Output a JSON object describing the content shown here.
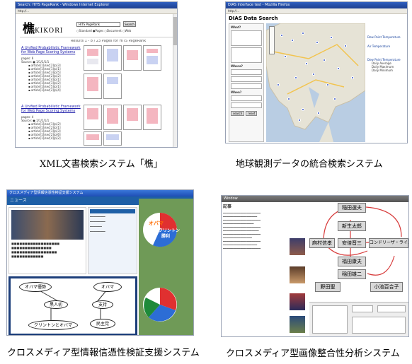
{
  "panels": {
    "kikori": {
      "window_title": "Search: HITS PageRank - Windows Internet Explorer",
      "logo_kanji": "樵",
      "logo_latin": "KIKORI",
      "search_value": "HITS PageRank",
      "search_button": "Search",
      "results_text": "Results 1 - 8 / 23 Pages for HITS PageRank",
      "result_title_1": "A Unified Probabilistic Framework for Web Page Scoring Systems",
      "result_title_2": "A Unified Probabilistic Framework for Web Page Scoring Systems",
      "caption": "XML文書検索システム「樵」"
    },
    "dias": {
      "window_title": "DIAS Interface test - Mozilla Firefox",
      "page_title": "DIAS Data Search",
      "label_what": "What?",
      "label_where": "Where?",
      "label_when": "When?",
      "search_button": "search",
      "reset_button": "reset",
      "legend_items": [
        "Dew Point Temperature",
        "Air Temperature",
        "Dew Point Temperature",
        "Daily Average",
        "Daily Maximum",
        "Daily Minimum"
      ],
      "caption": "地球観測データの統合検索システム"
    },
    "crossmedia_news": {
      "window_title": "クロスメディア型情報信憑性検証支援システム",
      "news_header": "ニュース",
      "pie_labels": [
        "オバマ",
        "クリントン",
        "勝利"
      ],
      "ovals": [
        "オバマ優勢",
        "オバマ",
        "黒人初",
        "支持",
        "クリントンとオバマ",
        "民主党"
      ],
      "caption": "クロスメディア型情報信憑性検証支援システム"
    },
    "image_consistency": {
      "nodes": [
        "稲田選夫",
        "新生太郎",
        "安倍晋三",
        "コンドリーザ・ライス",
        "麻村信孝",
        "福田康夫",
        "稲田雄二",
        "小池百合子",
        "野田聖"
      ],
      "caption": "クロスメディア型画像整合性分析システム"
    }
  }
}
